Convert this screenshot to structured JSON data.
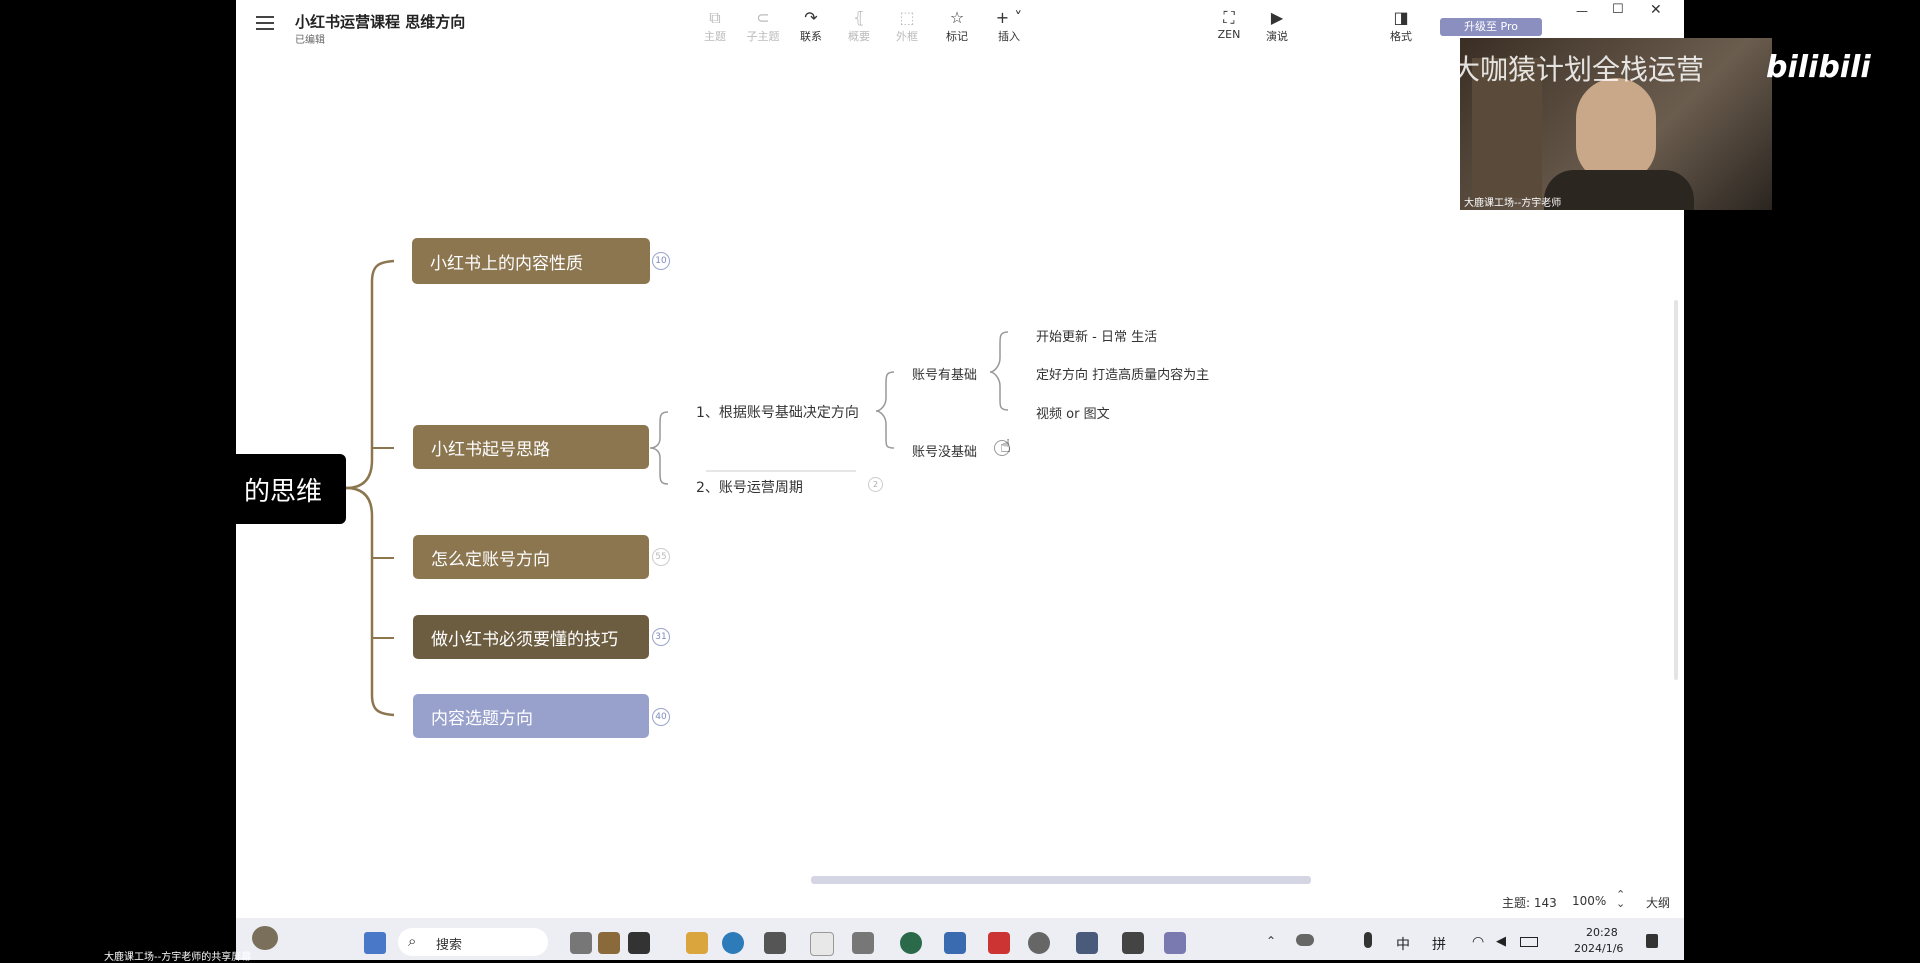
{
  "window": {
    "title": "小红书运营课程 思维方向",
    "subtitle": "已编辑",
    "controls": {
      "minimize": "—",
      "maximize": "☐",
      "close": "✕"
    }
  },
  "toolbar": {
    "items": [
      {
        "label": "主题",
        "icon": "topic-icon",
        "glyph": "⧉"
      },
      {
        "label": "子主题",
        "icon": "subtopic-icon",
        "glyph": "⊂"
      },
      {
        "label": "联系",
        "icon": "relationship-icon",
        "glyph": "↷"
      },
      {
        "label": "概要",
        "icon": "summary-icon",
        "glyph": "⦃"
      },
      {
        "label": "外框",
        "icon": "boundary-icon",
        "glyph": "⬚"
      },
      {
        "label": "标记",
        "icon": "star-icon",
        "glyph": "☆"
      },
      {
        "label": "插入",
        "icon": "plus-icon",
        "glyph": "+ ˅"
      },
      {
        "label": "ZEN",
        "icon": "fullscreen-icon",
        "glyph": "⛶"
      },
      {
        "label": "演说",
        "icon": "play-icon",
        "glyph": "▶"
      },
      {
        "label": "格式",
        "icon": "panel-icon",
        "glyph": "◨"
      }
    ],
    "upgrade_label": "升级至 Pro"
  },
  "mindmap": {
    "root_label": "的思维",
    "topics": [
      {
        "label": "小红书上的内容性质",
        "count": "10",
        "color": "#8b7650"
      },
      {
        "label": "小红书起号思路",
        "count": "",
        "color": "#8b7650"
      },
      {
        "label": "怎么定账号方向",
        "count": "55",
        "color": "#8b7650"
      },
      {
        "label": "做小红书必须要懂的技巧",
        "count": "31",
        "color": "#6d5d40"
      },
      {
        "label": "内容选题方向",
        "count": "40",
        "color": "#98a0cc"
      }
    ],
    "subtopics": [
      {
        "label": "1、根据账号基础决定方向"
      },
      {
        "label": "2、账号运营周期",
        "count": "2"
      }
    ],
    "branches": [
      {
        "label": "账号有基础"
      },
      {
        "label": "账号没基础"
      }
    ],
    "leaves": [
      {
        "label": "开始更新 - 日常 生活"
      },
      {
        "label": "定好方向 打造高质量内容为主"
      },
      {
        "label": "视频 or 图文"
      }
    ]
  },
  "statusbar": {
    "topic_count": "主题: 143",
    "zoom": "100%",
    "outline_label": "大纲"
  },
  "overlay": {
    "watermark": "大咖猿计划全栈运营",
    "platform_logo": "bilibili",
    "webcam_caption": "大鹿课工场--方宇老师",
    "bottom_caption": "大鹿课工场--方宇老师的共享屏幕"
  },
  "taskbar": {
    "search_placeholder": "搜索",
    "tray": {
      "lang1": "中",
      "lang2": "拼",
      "time": "20:28",
      "date": "2024/1/6"
    }
  }
}
